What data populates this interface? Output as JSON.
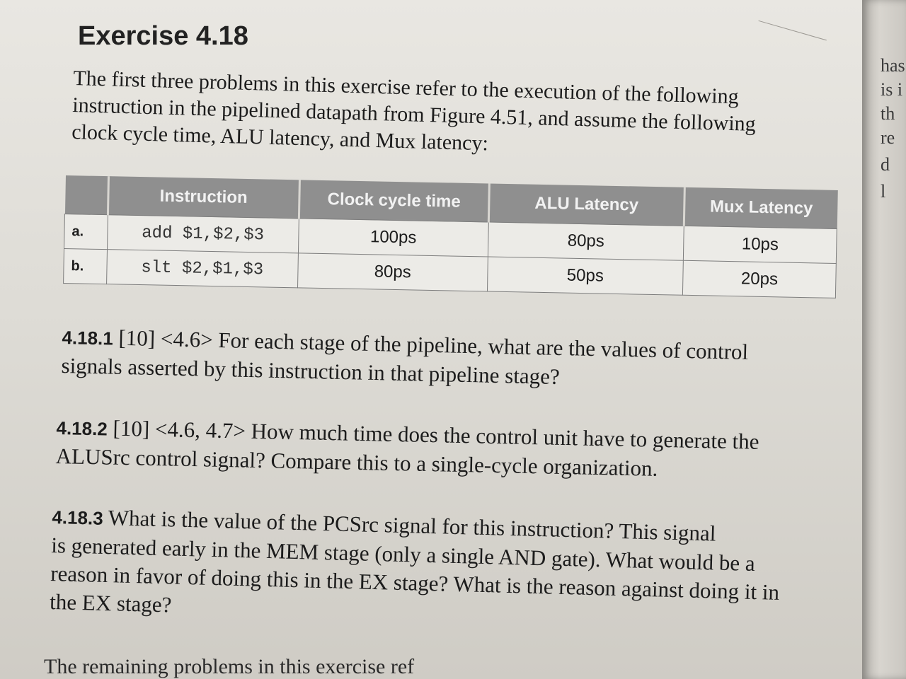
{
  "heading": "Exercise 4.18",
  "intro_lines": [
    "The first three problems in this exercise refer to the execution of the following",
    "instruction in the pipelined datapath from Figure 4.51, and assume the following",
    "clock cycle time, ALU latency, and Mux latency:"
  ],
  "table": {
    "headers": [
      "",
      "Instruction",
      "Clock cycle time",
      "ALU Latency",
      "Mux Latency"
    ],
    "rows": [
      {
        "label": "a.",
        "instruction": "add $1,$2,$3",
        "clock": "100ps",
        "alu": "80ps",
        "mux": "10ps"
      },
      {
        "label": "b.",
        "instruction": "slt $2,$1,$3",
        "clock": "80ps",
        "alu": "50ps",
        "mux": "20ps"
      }
    ]
  },
  "problems": [
    {
      "num": "4.18.1",
      "lines": [
        "[10] <4.6> For each stage of the pipeline, what are the values of control",
        "signals asserted by this instruction in that pipeline stage?"
      ]
    },
    {
      "num": "4.18.2",
      "lines": [
        "[10] <4.6, 4.7> How much time does the control unit have to generate the",
        "ALUSrc control signal? Compare this to a single-cycle organization."
      ]
    },
    {
      "num": "4.18.3",
      "lines": [
        "What is the value of the PCSrc signal for this instruction? This signal",
        "is generated early in the MEM stage (only a single AND gate). What would be a",
        "reason in favor of doing this in the EX stage? What is the reason against doing it in",
        "the EX stage?"
      ]
    }
  ],
  "footer": "The remaining problems in this exercise ref",
  "margin_fragments": [
    "has",
    "is i",
    "th",
    "re",
    "d",
    "l"
  ]
}
